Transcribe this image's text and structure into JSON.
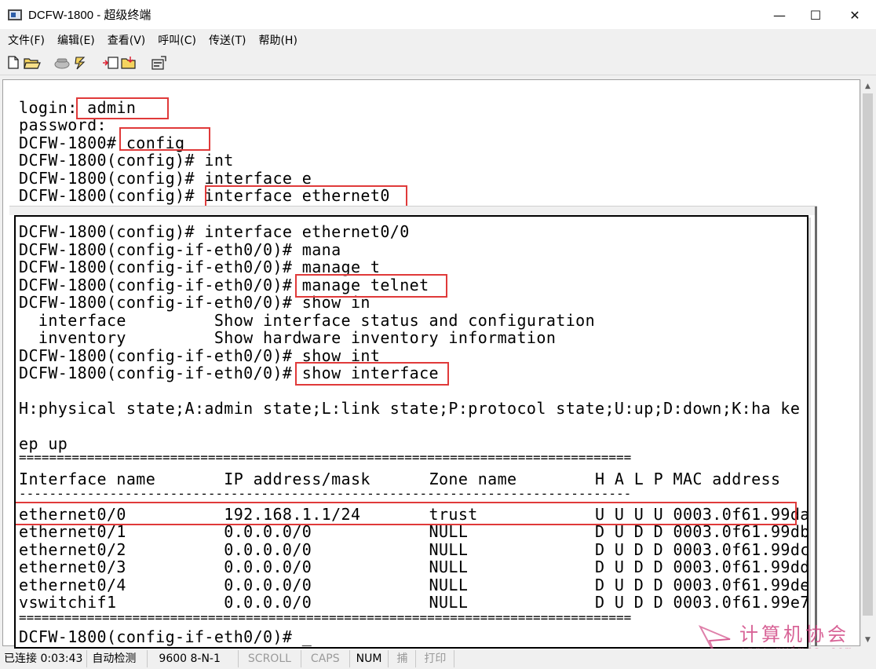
{
  "window": {
    "title": "DCFW-1800 - 超级终端",
    "minimize": "—",
    "maximize": "☐",
    "close": "✕"
  },
  "menu": [
    "文件(F)",
    "编辑(E)",
    "查看(V)",
    "呼叫(C)",
    "传送(T)",
    "帮助(H)"
  ],
  "toolbar": {
    "icons": [
      "new-file-icon",
      "open-folder-icon",
      "phone-icon",
      "disconnect-icon",
      "send-icon",
      "receive-icon",
      "properties-icon"
    ]
  },
  "terminal": {
    "lines": [
      "login: admin",
      "password:",
      "DCFW-1800# config",
      "DCFW-1800(config)# int",
      "DCFW-1800(config)# interface e",
      "DCFW-1800(config)# interface ethernet0"
    ]
  },
  "inset": {
    "lines": [
      "DCFW-1800(config)# interface ethernet0/0",
      "DCFW-1800(config-if-eth0/0)# mana",
      "DCFW-1800(config-if-eth0/0)# manage t",
      "DCFW-1800(config-if-eth0/0)# manage telnet",
      "DCFW-1800(config-if-eth0/0)# show in",
      "  interface         Show interface status and configuration",
      "  inventory         Show hardware inventory information",
      "DCFW-1800(config-if-eth0/0)# show int",
      "DCFW-1800(config-if-eth0/0)# show interface",
      "",
      "H:physical state;A:admin state;L:link state;P:protocol state;U:up;D:down;K:ha ke",
      "",
      "ep up",
      "=================================================================================",
      "Interface name       IP address/mask      Zone name        H A L P MAC address",
      "---------------------------------------------------------------------------------",
      "ethernet0/0          192.168.1.1/24       trust            U U U U 0003.0f61.99da",
      "ethernet0/1          0.0.0.0/0            NULL             D U D D 0003.0f61.99db",
      "ethernet0/2          0.0.0.0/0            NULL             D U D D 0003.0f61.99dc",
      "ethernet0/3          0.0.0.0/0            NULL             D U D D 0003.0f61.99dd",
      "ethernet0/4          0.0.0.0/0            NULL             D U D D 0003.0f61.99de",
      "vswitchif1           0.0.0.0/0            NULL             D U D D 0003.0f61.99e7",
      "=================================================================================",
      "DCFW-1800(config-if-eth0/0)# _"
    ]
  },
  "status": {
    "connected": "已连接 0:03:43",
    "detect": "自动检测",
    "params": "9600 8-N-1",
    "scroll": "SCROLL",
    "caps": "CAPS",
    "num": "NUM",
    "capture": "捕",
    "print": "打印"
  },
  "watermark": {
    "title": "计算机协会",
    "url": "www.gxjmca.com"
  },
  "colors": {
    "highlight": "#e03a3a",
    "watermark": "#d24a86"
  }
}
